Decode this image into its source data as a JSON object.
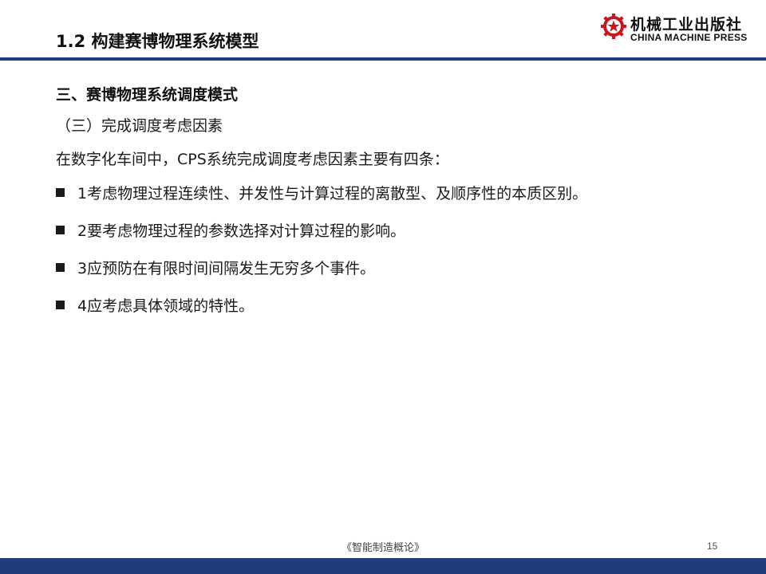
{
  "header": {
    "title": "1.2 构建赛博物理系统模型"
  },
  "logo": {
    "name_cn": "机械工业出版社",
    "name_en": "CHINA MACHINE PRESS",
    "seal_icon": "gear-star-seal-icon"
  },
  "content": {
    "section_heading": "三、赛博物理系统调度模式",
    "subheading": "（三）完成调度考虑因素",
    "intro": "在数字化车间中，CPS系统完成调度考虑因素主要有四条：",
    "bullets": [
      "1考虑物理过程连续性、并发性与计算过程的离散型、及顺序性的本质区别。",
      "2要考虑物理过程的参数选择对计算过程的影响。",
      "3应预防在有限时间间隔发生无穷多个事件。",
      "4应考虑具体领域的特性。"
    ]
  },
  "footer": {
    "book_title": "《智能制造概论》",
    "page_number": "15"
  },
  "colors": {
    "accent_blue": "#1f3d7a",
    "logo_red": "#c8161d"
  }
}
